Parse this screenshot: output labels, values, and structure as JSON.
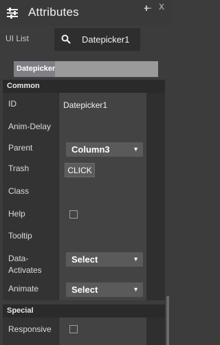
{
  "header": {
    "title": "Attributes",
    "icons": [
      "sliders-icon",
      "pin-icon",
      "close-icon"
    ],
    "close_glyph": "X"
  },
  "uilist": {
    "label": "UI List",
    "value": "Datepicker1",
    "icon": "search-icon"
  },
  "tab": {
    "label": "Datepicker"
  },
  "sections": {
    "common": "Common",
    "special": "Special"
  },
  "properties": {
    "id": {
      "label": "ID",
      "value": "Datepicker1"
    },
    "anim_delay": {
      "label": "Anim-Delay",
      "value": ""
    },
    "parent": {
      "label": "Parent",
      "value": "Column3"
    },
    "trash": {
      "label": "Trash",
      "button": "CLICK"
    },
    "class": {
      "label": "Class",
      "value": ""
    },
    "help": {
      "label": "Help",
      "checked": false
    },
    "tooltip": {
      "label": "Tooltip",
      "value": ""
    },
    "data_activates": {
      "label_line1": "Data-",
      "label_line2": "Activates",
      "value": "Select"
    },
    "animate": {
      "label": "Animate",
      "value": "Select"
    },
    "responsive": {
      "label": "Responsive",
      "checked": false
    }
  },
  "colors": {
    "panel_bg": "#3c3c3c",
    "section_bg": "#2a2a2a",
    "label_bg": "#333333",
    "value_bg": "#434343",
    "dropdown_bg": "#5a5a5a",
    "tab_chip": "#7f7f86"
  }
}
